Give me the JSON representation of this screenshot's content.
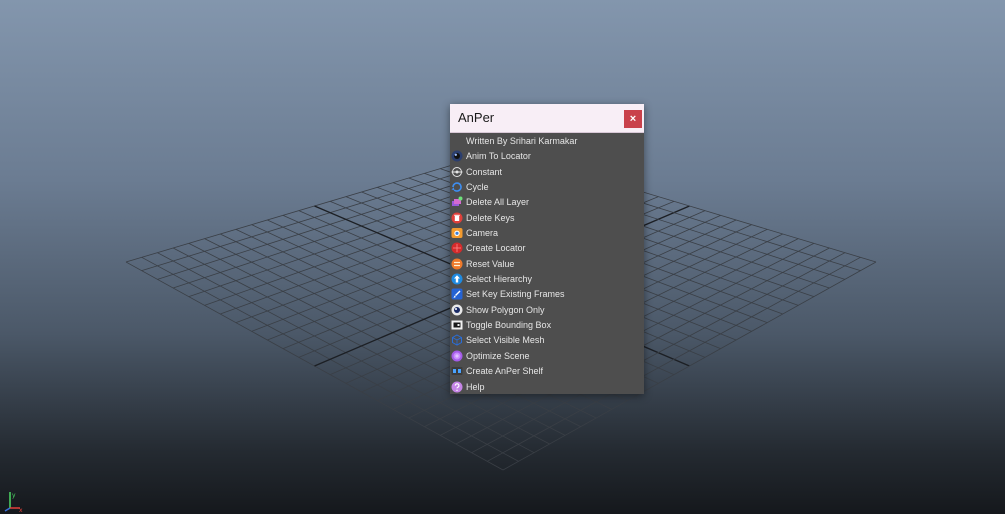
{
  "window": {
    "title": "AnPer",
    "close_label": "×"
  },
  "menu": {
    "items": [
      {
        "label": "Written By Srihari Karmakar",
        "icon": "none"
      },
      {
        "label": "Anim To Locator",
        "icon": "anim-to-locator-icon"
      },
      {
        "label": "Constant",
        "icon": "constant-icon"
      },
      {
        "label": "Cycle",
        "icon": "cycle-icon"
      },
      {
        "label": "Delete All Layer",
        "icon": "delete-layer-icon"
      },
      {
        "label": "Delete Keys",
        "icon": "delete-keys-icon"
      },
      {
        "label": "Camera",
        "icon": "camera-icon"
      },
      {
        "label": "Create Locator",
        "icon": "locator-icon"
      },
      {
        "label": "Reset Value",
        "icon": "reset-value-icon"
      },
      {
        "label": "Select Hierarchy",
        "icon": "select-hierarchy-icon"
      },
      {
        "label": "Set Key Existing Frames",
        "icon": "set-key-icon"
      },
      {
        "label": "Show Polygon Only",
        "icon": "show-polygon-icon"
      },
      {
        "label": "Toggle Bounding Box",
        "icon": "bounding-box-icon"
      },
      {
        "label": "Select Visible Mesh",
        "icon": "visible-mesh-icon"
      },
      {
        "label": "Optimize Scene",
        "icon": "optimize-scene-icon"
      },
      {
        "label": "Create AnPer Shelf",
        "icon": "shelf-icon"
      },
      {
        "label": "Help",
        "icon": "help-icon"
      }
    ]
  },
  "colors": {
    "close_button": "#c9414b",
    "title_bar": "#f8eef6",
    "menu_background": "#4e4e4e"
  }
}
